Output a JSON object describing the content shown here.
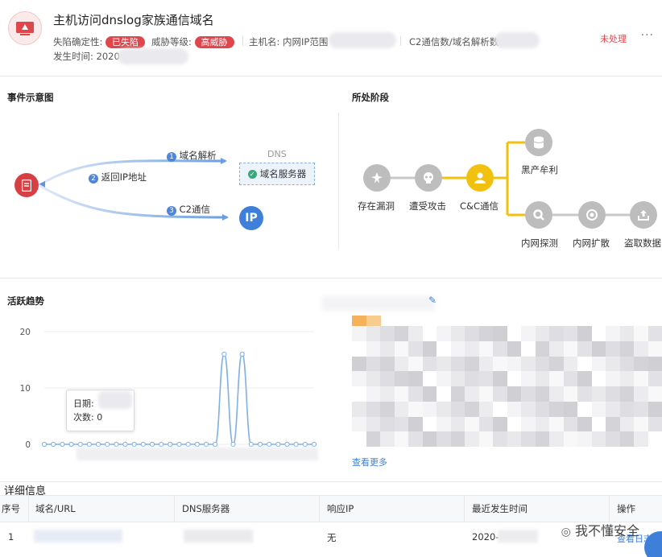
{
  "header": {
    "title": "主机访问dnslog家族通信域名",
    "fields": {
      "compromise_label": "失陷确定性:",
      "compromise_badge": "已失陷",
      "threat_label": "威胁等级:",
      "threat_badge": "高威胁",
      "host_label": "主机名: 内网IP范围",
      "c2_label": "C2通信数/域名解析数:",
      "time_label": "发生时间: 2020"
    },
    "status": "未处理",
    "more": "···"
  },
  "event_diagram": {
    "title": "事件示意图",
    "steps": [
      {
        "num": "1",
        "label": "域名解析"
      },
      {
        "num": "2",
        "label": "返回IP地址"
      },
      {
        "num": "3",
        "label": "C2通信"
      }
    ],
    "dns_label": "DNS",
    "dns_server": "域名服务器",
    "ip_label": "IP"
  },
  "stages": {
    "title": "所处阶段",
    "items": [
      {
        "label": "存在漏洞",
        "icon": "vulnerability-icon"
      },
      {
        "label": "遭受攻击",
        "icon": "skull-icon"
      },
      {
        "label": "C&C通信",
        "icon": "user-icon"
      },
      {
        "label": "黑产牟利",
        "icon": "database-icon"
      },
      {
        "label": "内网探测",
        "icon": "search-icon"
      },
      {
        "label": "内网扩散",
        "icon": "target-icon"
      },
      {
        "label": "盗取数据",
        "icon": "upload-icon"
      }
    ],
    "active_color": "#f2c10f",
    "inactive_color": "#bdbdbd"
  },
  "activity": {
    "title": "活跃趋势",
    "tooltip_date_label": "日期:",
    "tooltip_count_label": "次数:",
    "tooltip_count_value": "0",
    "chart_data": {
      "type": "line",
      "title": "",
      "xlabel": "",
      "ylabel": "",
      "ylim": [
        0,
        20
      ],
      "yticks": [
        0,
        10,
        20
      ],
      "values": [
        0,
        0,
        0,
        0,
        0,
        0,
        0,
        0,
        0,
        0,
        0,
        0,
        0,
        0,
        0,
        0,
        0,
        0,
        0,
        0,
        16,
        0,
        16,
        0,
        0,
        0,
        0,
        0,
        0,
        0,
        0
      ],
      "color": "#7fb0e6"
    }
  },
  "suggestion": {
    "see_more": "查看更多"
  },
  "details": {
    "title": "详细信息",
    "columns": [
      "序号",
      "域名/URL",
      "DNS服务器",
      "响应IP",
      "最近发生时间",
      "操作"
    ],
    "rows": [
      {
        "index": "1",
        "response_ip": "无",
        "time": "2020-",
        "action": "查看日志"
      }
    ]
  },
  "watermark": "我不懂安全"
}
